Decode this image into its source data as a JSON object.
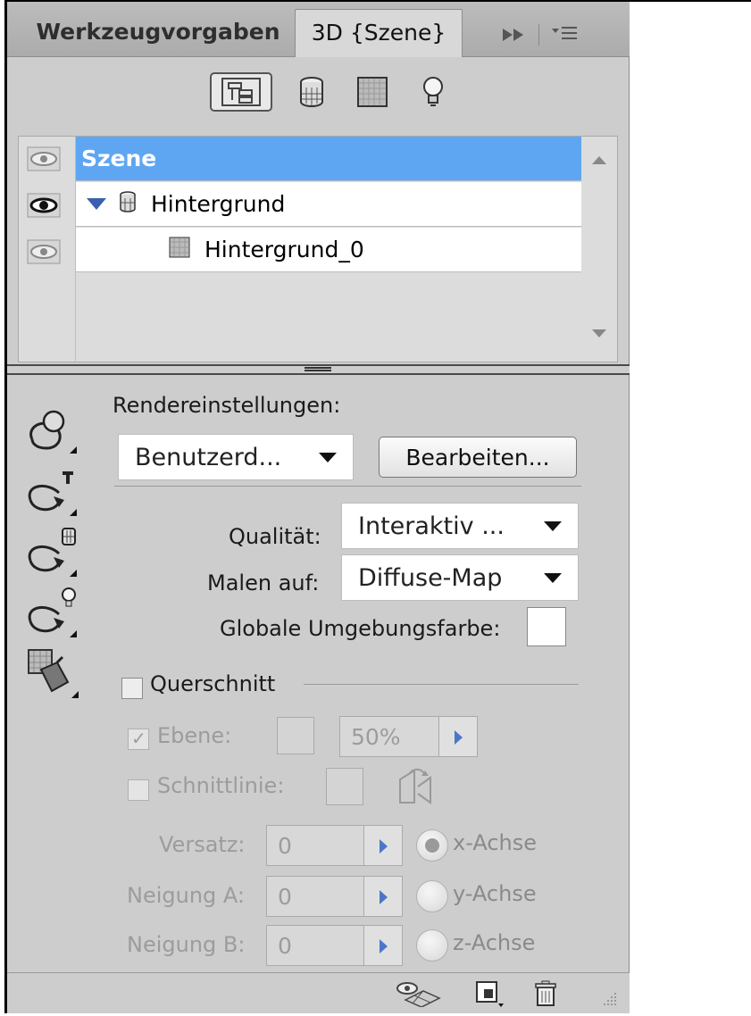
{
  "tabs": {
    "inactive": "Werkzeugvorgaben",
    "active": "3D {Szene}",
    "menu_icons": [
      "fast-forward-icon",
      "panel-menu-icon"
    ]
  },
  "filters": [
    "scene-filter-icon",
    "mesh-filter-icon",
    "material-filter-icon",
    "light-filter-icon"
  ],
  "layers": {
    "rows": [
      {
        "label": "Szene",
        "selected": true
      },
      {
        "label": "Hintergrund",
        "selected": false
      },
      {
        "label": "Hintergrund_0",
        "selected": false
      }
    ]
  },
  "render": {
    "section_label": "Rendereinstellungen:",
    "preset_value": "Benutzerd...",
    "edit_button": "Bearbeiten...",
    "quality_label": "Qualität:",
    "quality_value": "Interaktiv ...",
    "paint_label": "Malen auf:",
    "paint_value": "Diffuse-Map",
    "ambient_label": "Globale Umgebungsfarbe:"
  },
  "cross_section": {
    "label": "Querschnitt",
    "plane_label": "Ebene:",
    "plane_percent": "50%",
    "intersection_label": "Schnittlinie:",
    "offset_label": "Versatz:",
    "offset_value": "0",
    "tilt_a_label": "Neigung A:",
    "tilt_a_value": "0",
    "tilt_b_label": "Neigung B:",
    "tilt_b_value": "0",
    "x_axis": "x-Achse",
    "y_axis": "y-Achse",
    "z_axis": "z-Achse"
  },
  "colors": {
    "selection": "#5fa6f2",
    "panel": "#cdcdcd",
    "arrow": "#4b76c8"
  }
}
